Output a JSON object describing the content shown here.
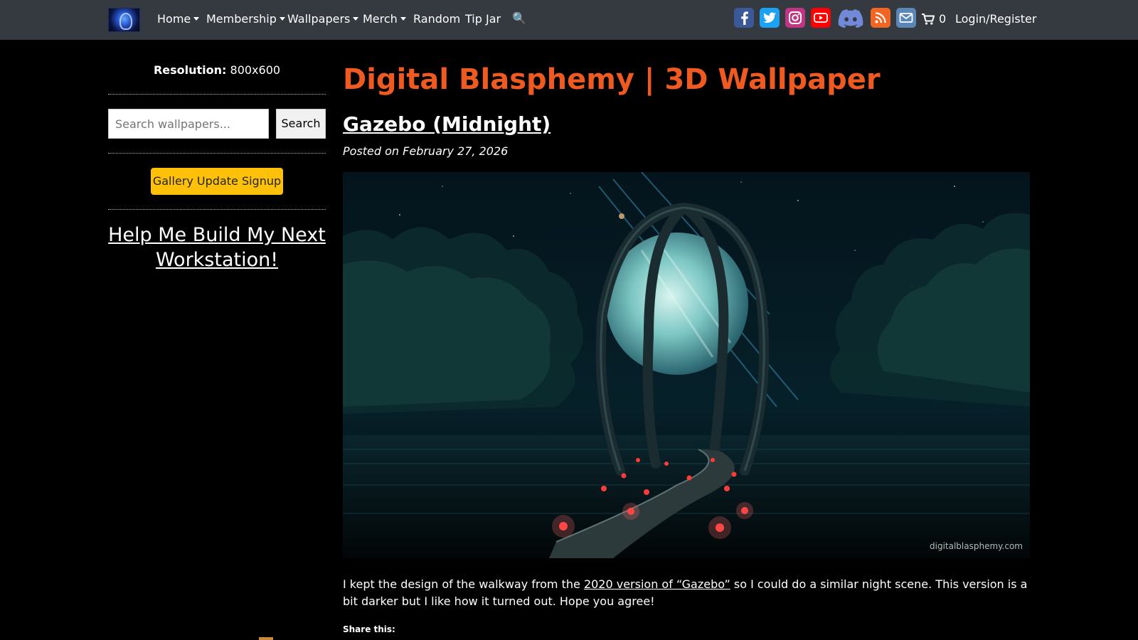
{
  "navbar": {
    "logo": "digital-blasphemy-logo",
    "items": [
      {
        "label": "Home",
        "dropdown": true
      },
      {
        "label": "Membership",
        "dropdown": true
      },
      {
        "label": "Wallpapers",
        "dropdown": true
      },
      {
        "label": "Merch",
        "dropdown": true
      },
      {
        "label": "Random",
        "dropdown": false
      },
      {
        "label": "Tip Jar",
        "dropdown": false
      }
    ],
    "search_icon": "🔍",
    "social": [
      {
        "name": "facebook-icon",
        "color": "#3b5998"
      },
      {
        "name": "twitter-icon",
        "color": "#1da1f2"
      },
      {
        "name": "instagram-icon",
        "color": "#c13584"
      },
      {
        "name": "youtube-icon",
        "color": "#ff0000"
      },
      {
        "name": "discord-icon",
        "color": "#7289da"
      },
      {
        "name": "rss-icon",
        "color": "#f26522"
      },
      {
        "name": "email-icon",
        "color": "#5b87b8"
      }
    ],
    "cart_count": "0",
    "login_label": "Login/Register"
  },
  "sidebar": {
    "resolution_label": "Resolution:",
    "resolution_value": "800x600",
    "search_placeholder": "Search wallpapers...",
    "search_button": "Search",
    "signup_button": "Gallery Update Signup",
    "help_link": "Help Me Build My Next Workstation!"
  },
  "main": {
    "site_title": "Digital Blasphemy | 3D Wallpaper",
    "post_title": "Gazebo (Midnight)",
    "posted_on": "Posted on February 27, 2026",
    "watermark": "digitalblasphemy.com",
    "body_before": "I kept the design of the walkway from the ",
    "body_link": "2020 version of “Gazebo”",
    "body_after": " so I could do a similar night scene.    This version is a bit darker but I like how it turned out.   Hope you agree!",
    "share_label": "Share this:"
  },
  "colors": {
    "navbar_bg": "#343a40",
    "title_accent": "#ef5a21",
    "signup_button": "#ffc107"
  }
}
